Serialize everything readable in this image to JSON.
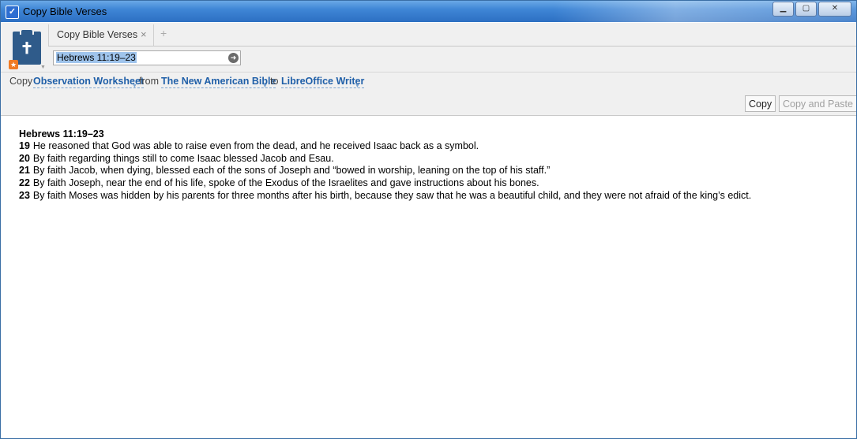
{
  "window": {
    "title": "Copy Bible Verses",
    "controls": {
      "minimize": "▁",
      "maximize": "▢",
      "close": "✕"
    }
  },
  "tab": {
    "label": "Copy Bible Verses",
    "close": "×",
    "add": "+"
  },
  "reference": {
    "value": "Hebrews 11:19–23",
    "go_icon": "arrow-right-circle"
  },
  "options": {
    "copy_label": "Copy",
    "content_type": "Observation Worksheet",
    "from_label": "from",
    "bible": "The New American Bible",
    "to_label": "to",
    "target": "LibreOffice Writer"
  },
  "buttons": {
    "copy": "Copy",
    "copy_and_paste": "Copy and Paste"
  },
  "passage": {
    "reference": "Hebrews 11:19–23",
    "verses": [
      {
        "num": "19",
        "text": "He reasoned that God was able to raise even from the dead, and he received Isaac back as a symbol."
      },
      {
        "num": "20",
        "text": "By faith regarding things still to come Isaac blessed Jacob and Esau."
      },
      {
        "num": "21",
        "text": "By faith Jacob, when dying, blessed each of the sons of Joseph and “bowed in worship, leaning on the top of his staff.”"
      },
      {
        "num": "22",
        "text": "By faith Joseph, near the end of his life, spoke of the Exodus of the Israelites and gave instructions about his bones."
      },
      {
        "num": "23",
        "text": "By faith Moses was hidden by his parents for three months after his birth, because they saw that he was a beautiful child, and they were not afraid of the king’s edict."
      }
    ]
  },
  "colors": {
    "link": "#1f5fa8",
    "titlebar": "#3f86d6",
    "panel_icon": "#2f5b8a",
    "badge": "#f07a22"
  }
}
